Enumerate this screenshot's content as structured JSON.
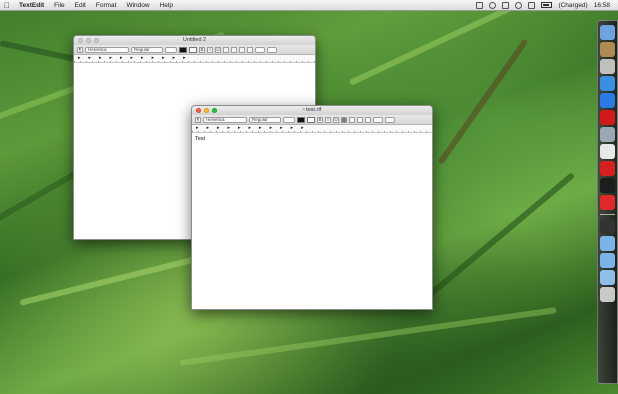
{
  "menubar": {
    "apple_icon": "apple-icon",
    "app_name": "TextEdit",
    "items": [
      "File",
      "Edit",
      "Format",
      "Window",
      "Help"
    ],
    "battery_status": "(Charged)",
    "time": "16:58"
  },
  "windows": {
    "back": {
      "title": "Untitled 2",
      "toolbar": {
        "font_family": "Helvetica",
        "font_style": "Regular"
      }
    },
    "front": {
      "title": "test.rtf",
      "toolbar": {
        "font_family": "Helvetica",
        "font_style": "Regular"
      },
      "content": "Test"
    }
  },
  "dock": {
    "icons": [
      "finder-icon",
      "photo-icon",
      "launchpad-icon",
      "safari-icon",
      "app-store-icon",
      "opera-icon",
      "preview-icon",
      "calendar-icon",
      "x11-icon",
      "activity-monitor-icon",
      "stop-icon",
      "terminal-icon",
      "folder-icon",
      "folder-icon",
      "downloads-icon",
      "trash-icon"
    ],
    "colors": [
      "#6fa3e0",
      "#b08a55",
      "#c0c0c0",
      "#3b8fe0",
      "#2c7be5",
      "#d11a1a",
      "#9aa7b5",
      "#e8e8e8",
      "#d62020",
      "#1d1d1d",
      "#e02a2a",
      "#333333",
      "#79b3e8",
      "#79b3e8",
      "#8fbfe8",
      "#c9c9c9"
    ]
  }
}
